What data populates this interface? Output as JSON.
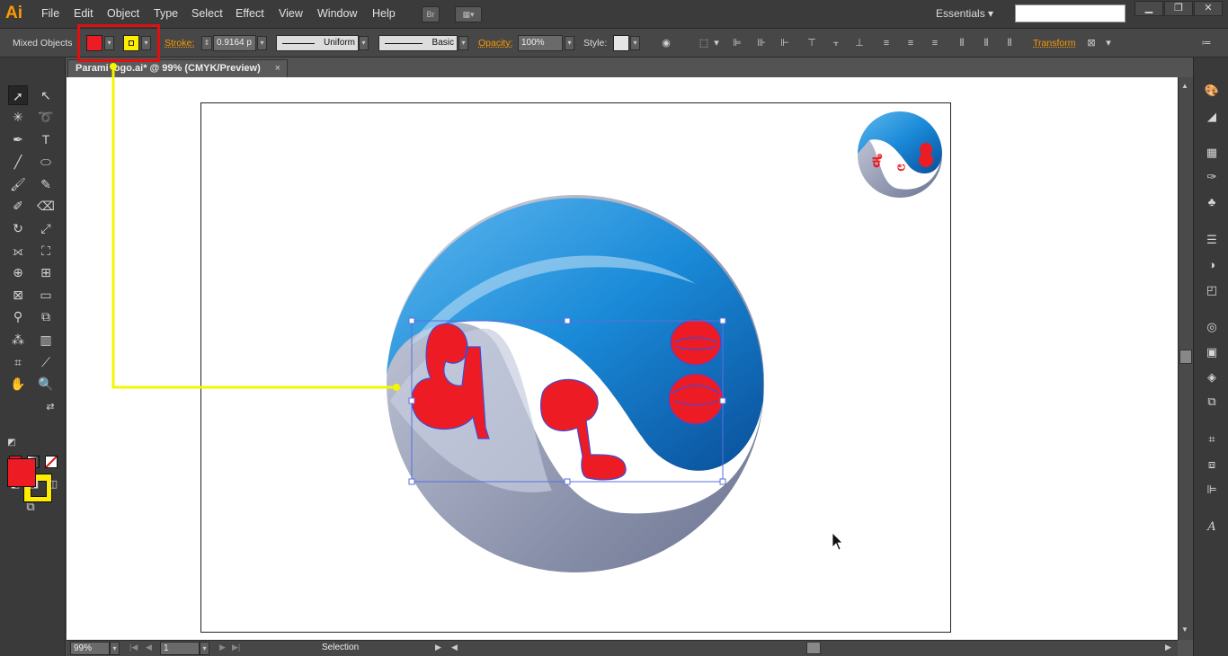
{
  "app": {
    "logo": "Ai"
  },
  "menu": [
    "File",
    "Edit",
    "Object",
    "Type",
    "Select",
    "Effect",
    "View",
    "Window",
    "Help"
  ],
  "menubar": {
    "bridge_label": "Br",
    "workspace": "Essentials",
    "search_placeholder": ""
  },
  "control": {
    "selection_type": "Mixed Objects",
    "fill_color": "#ed1c24",
    "stroke_color": "#ffed00",
    "stroke_label": "Stroke:",
    "stroke_weight": "0.9164 p",
    "profile": "Uniform",
    "brush": "Basic",
    "opacity_label": "Opacity:",
    "opacity_value": "100%",
    "style_label": "Style:",
    "transform_label": "Transform"
  },
  "document": {
    "tab_title": "Parami logo.ai* @ 99% (CMYK/Preview)",
    "close": "×"
  },
  "status": {
    "zoom": "99%",
    "page": "1",
    "tool": "Selection"
  },
  "tools": {
    "selection": "selection-tool",
    "direct": "direct-selection-tool"
  },
  "colors": {
    "accent": "#ff9a00",
    "highlight": "#e01010",
    "callout": "#f5f500",
    "logo_blue": "#0a78c8",
    "logo_gray": "#8a92aa"
  }
}
